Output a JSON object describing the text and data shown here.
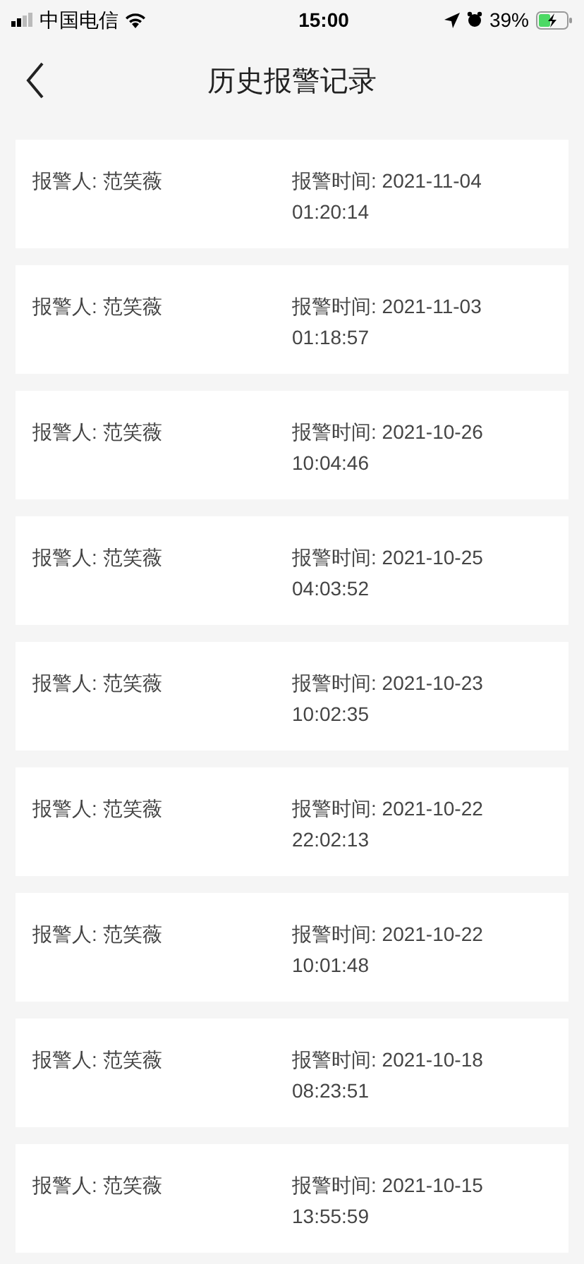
{
  "status_bar": {
    "carrier": "中国电信",
    "time": "15:00",
    "battery": "39%"
  },
  "nav": {
    "title": "历史报警记录"
  },
  "records": [
    {
      "reporter": "报警人: 范笑薇",
      "time": "报警时间: 2021-11-04 01:20:14"
    },
    {
      "reporter": "报警人: 范笑薇",
      "time": "报警时间: 2021-11-03 01:18:57"
    },
    {
      "reporter": "报警人: 范笑薇",
      "time": "报警时间: 2021-10-26 10:04:46"
    },
    {
      "reporter": "报警人: 范笑薇",
      "time": "报警时间: 2021-10-25 04:03:52"
    },
    {
      "reporter": "报警人: 范笑薇",
      "time": "报警时间: 2021-10-23 10:02:35"
    },
    {
      "reporter": "报警人: 范笑薇",
      "time": "报警时间: 2021-10-22 22:02:13"
    },
    {
      "reporter": "报警人: 范笑薇",
      "time": "报警时间: 2021-10-22 10:01:48"
    },
    {
      "reporter": "报警人: 范笑薇",
      "time": "报警时间: 2021-10-18 08:23:51"
    },
    {
      "reporter": "报警人: 范笑薇",
      "time": "报警时间: 2021-10-15 13:55:59"
    }
  ]
}
